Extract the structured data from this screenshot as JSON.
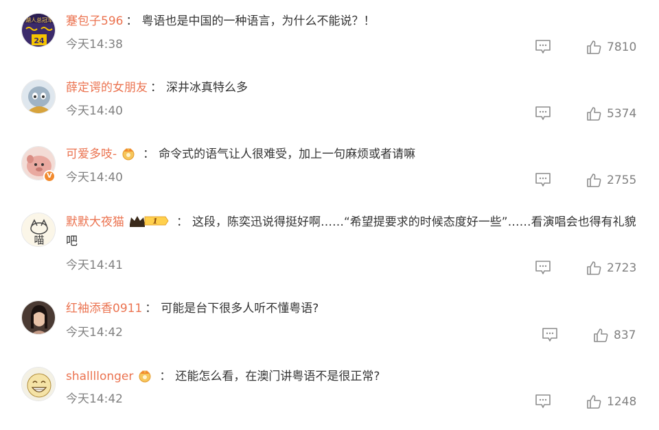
{
  "comments": [
    {
      "username": "蹇包子596",
      "separator": "：",
      "text": "粤语也是中国的一种语言，为什么不能说？！",
      "time": "今天14:38",
      "likes": "7810"
    },
    {
      "username": "薛定谔的女朋友",
      "separator": "：",
      "text": "深井冰真特么多",
      "time": "今天14:40",
      "likes": "5374"
    },
    {
      "username": "可爱多吱-",
      "separator": "：",
      "text": "命令式的语气让人很难受，加上一句麻烦或者请嘛",
      "time": "今天14:40",
      "likes": "2755"
    },
    {
      "username": "默默大夜猫",
      "separator": "：",
      "text": "这段，陈奕迅说得挺好啊……“希望提要求的时候态度好一些”……看演唱会也得有礼貌吧",
      "time": "今天14:41",
      "likes": "2723",
      "badge_level": "1"
    },
    {
      "username": "红袖添香0911",
      "separator": "：",
      "text": "可能是台下很多人听不懂粤语?",
      "time": "今天14:42",
      "likes": "837"
    },
    {
      "username": "shallllonger",
      "separator": "：",
      "text": "还能怎么看，在澳门讲粤语不是很正常?",
      "time": "今天14:42",
      "likes": "1248"
    }
  ],
  "avatar_0_text": "湖人总冠军",
  "avatar_0_num": "24",
  "avatar_3_text": "喵",
  "verified_mark": "V",
  "colors": {
    "username": "#eb7350",
    "meta": "#808080",
    "text": "#333333",
    "icon": "#8c8c8c"
  },
  "icons": {
    "reply": "comment-icon",
    "like": "thumbs-up-icon"
  }
}
